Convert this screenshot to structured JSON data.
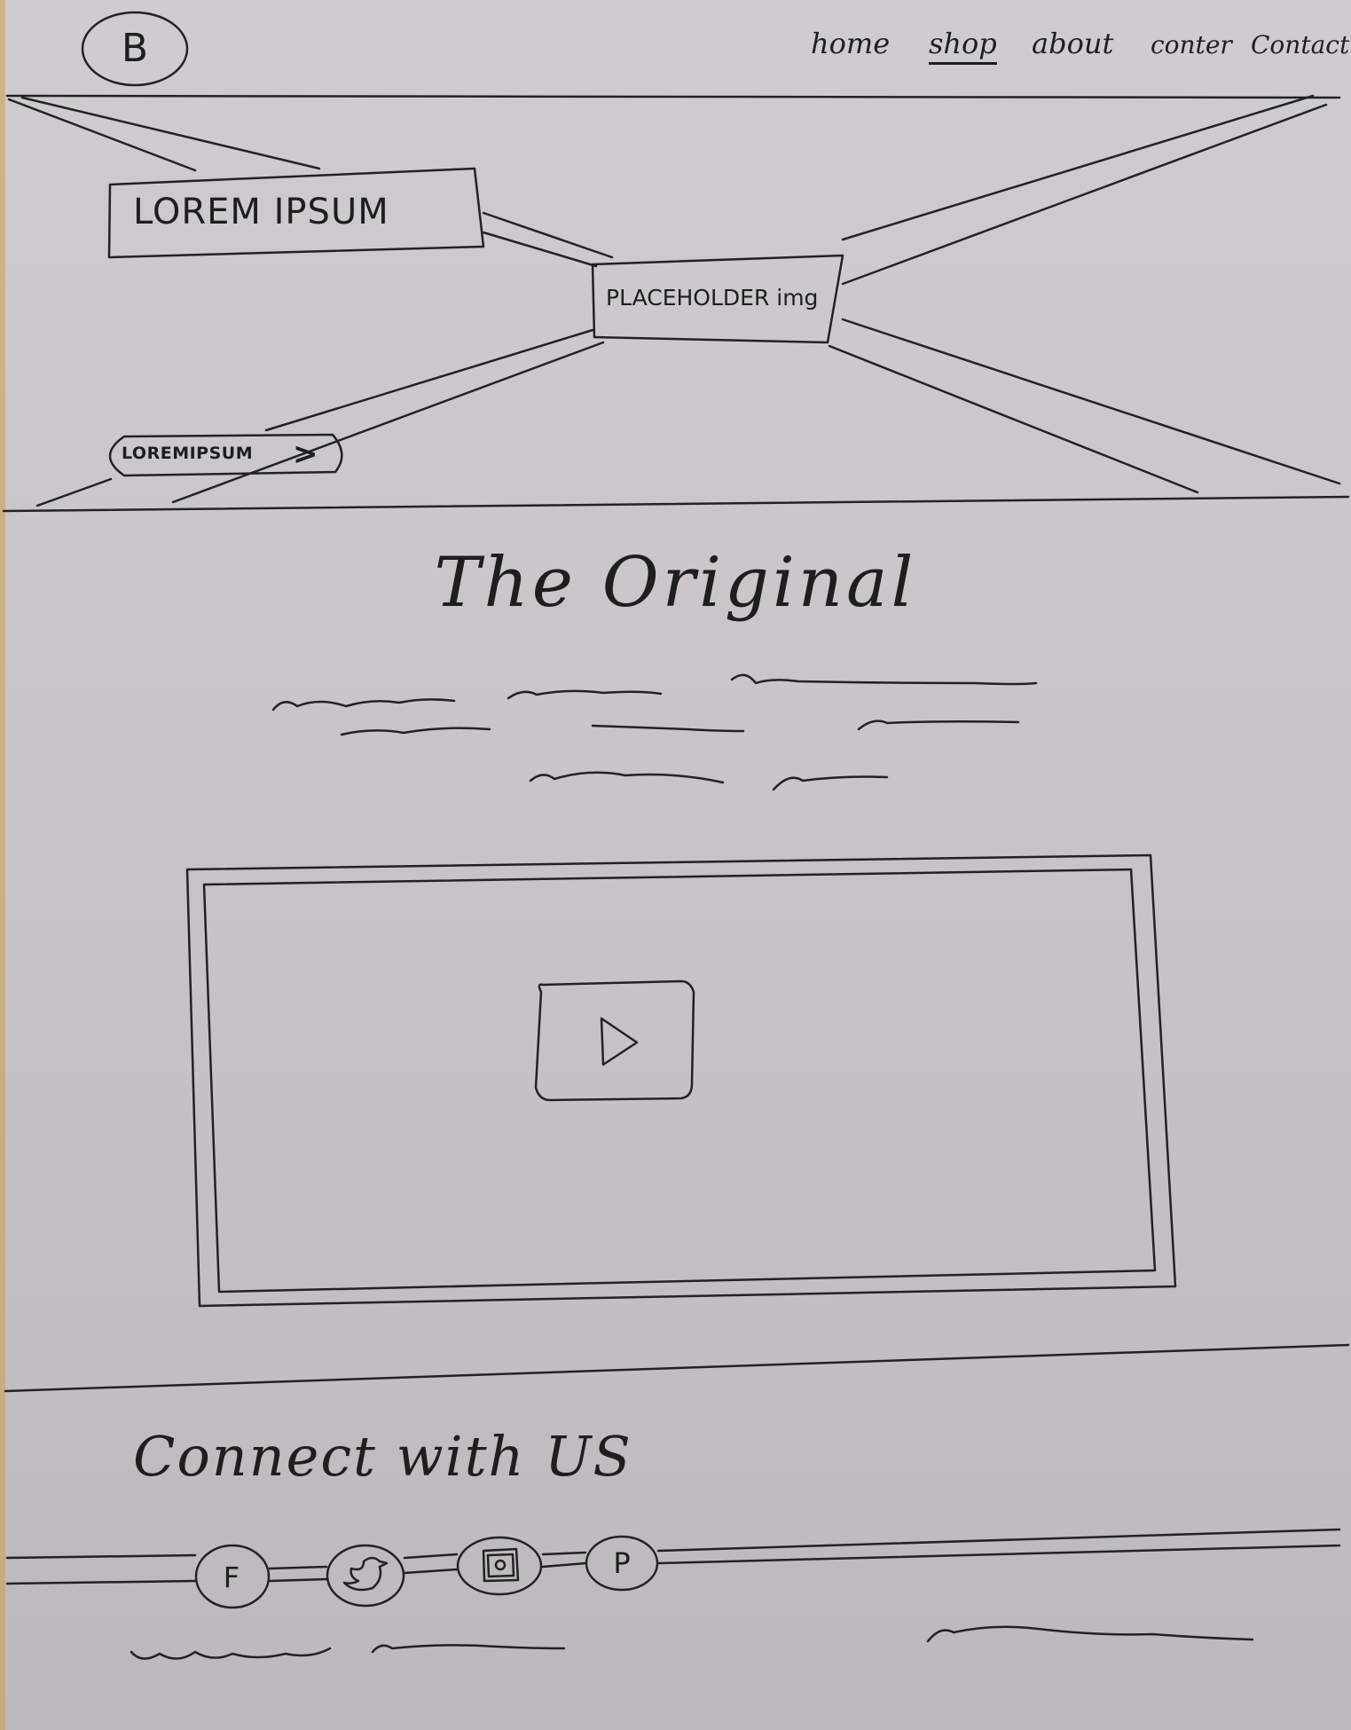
{
  "header": {
    "logo_letter": "B",
    "nav": {
      "home": "home",
      "shop": "shop",
      "about": "about",
      "conter": "conter",
      "contact": "Contact"
    }
  },
  "hero": {
    "title": "LOREM IPSUM",
    "image_label": "PLACEHOLDER img",
    "cta_label": "LOREMIPSUM",
    "cta_arrow": ">"
  },
  "section": {
    "title": "The Original"
  },
  "video": {
    "play_icon": "play-icon"
  },
  "connect": {
    "title": "Connect with US",
    "social": {
      "facebook": "F",
      "pinterest": "P"
    },
    "icons": [
      "facebook-icon",
      "twitter-icon",
      "instagram-icon",
      "pinterest-icon"
    ]
  },
  "colors": {
    "paper": "#c9c6c9",
    "ink": "#1e1e1e",
    "paper_edge": "#c9a24e"
  }
}
